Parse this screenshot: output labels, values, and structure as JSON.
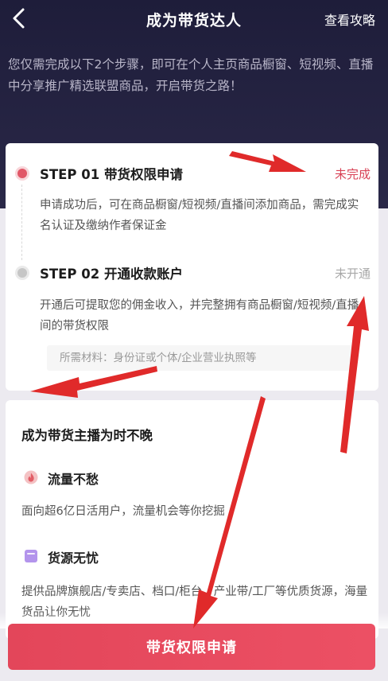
{
  "header": {
    "title": "成为带货达人",
    "guide_link": "查看攻略"
  },
  "intro": "您仅需完成以下2个步骤，即可在个人主页商品橱窗、短视频、直播中分享推广精选联盟商品，开启带货之路！",
  "steps": [
    {
      "title": "STEP 01 带货权限申请",
      "status": "未完成",
      "description": "申请成功后，可在商品橱窗/短视频/直播间添加商品，需完成实名认证及缴纳作者保证金"
    },
    {
      "title": "STEP 02 开通收款账户",
      "status": "未开通",
      "description": "开通后可提取您的佣金收入，并完整拥有商品橱窗/短视频/直播间的带货权限",
      "materials_label": "所需材料：",
      "materials_value": "身份证或个体/企业营业执照等"
    }
  ],
  "benefits": {
    "title": "成为带货主播为时不晚",
    "items": [
      {
        "name": "流量不愁",
        "description": "面向超6亿日活用户，流量机会等你挖掘",
        "icon": "flame-icon"
      },
      {
        "name": "货源无忧",
        "description": "提供品牌旗舰店/专卖店、档口/柜台、产业带/工厂等优质货源，海量货品让你无忧",
        "icon": "bag-icon"
      }
    ]
  },
  "cta": {
    "label": "带货权限申请"
  },
  "colors": {
    "accent": "#e3465a",
    "hero_bg": "#1e1d3a",
    "arrow": "#e02a2a"
  }
}
